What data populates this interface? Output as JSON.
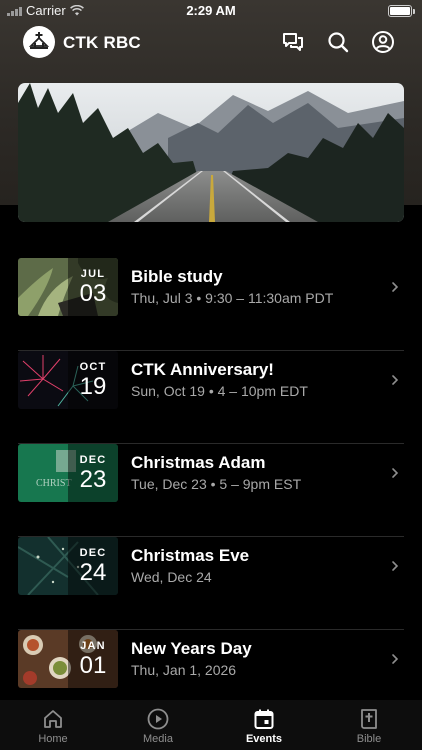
{
  "status_bar": {
    "carrier": "Carrier",
    "time": "2:29 AM"
  },
  "header": {
    "app_title": "CTK RBC",
    "icons": [
      "logo-icon",
      "chat-icon",
      "search-icon",
      "profile-icon"
    ]
  },
  "banner": {
    "image": "mountain-road-photo"
  },
  "events": [
    {
      "month": "JUL",
      "day": "03",
      "title": "Bible study",
      "subtitle": "Thu, Jul 3 • 9:30 – 11:30am PDT",
      "thumb": "plant-and-bible"
    },
    {
      "month": "OCT",
      "day": "19",
      "title": "CTK Anniversary!",
      "subtitle": "Sun, Oct 19 • 4 – 10pm EDT",
      "thumb": "fireworks"
    },
    {
      "month": "DEC",
      "day": "23",
      "title": "Christmas Adam",
      "subtitle": "Tue, Dec 23 • 5 – 9pm EST",
      "thumb": "green-christmas-card"
    },
    {
      "month": "DEC",
      "day": "24",
      "title": "Christmas Eve",
      "subtitle": "Wed, Dec 24",
      "thumb": "evergreen-branches"
    },
    {
      "month": "JAN",
      "day": "01",
      "title": "New Years Day",
      "subtitle": "Thu, Jan 1, 2026",
      "thumb": "food-table"
    }
  ],
  "tabs": [
    {
      "label": "Home",
      "icon": "home-icon",
      "active": false
    },
    {
      "label": "Media",
      "icon": "play-icon",
      "active": false
    },
    {
      "label": "Events",
      "icon": "calendar-icon",
      "active": true
    },
    {
      "label": "Bible",
      "icon": "bible-icon",
      "active": false
    }
  ],
  "colors": {
    "background": "#000000",
    "header_bg": "#2c2925",
    "subtitle": "#a9a9a9",
    "tab_inactive": "#8e8e8e"
  }
}
